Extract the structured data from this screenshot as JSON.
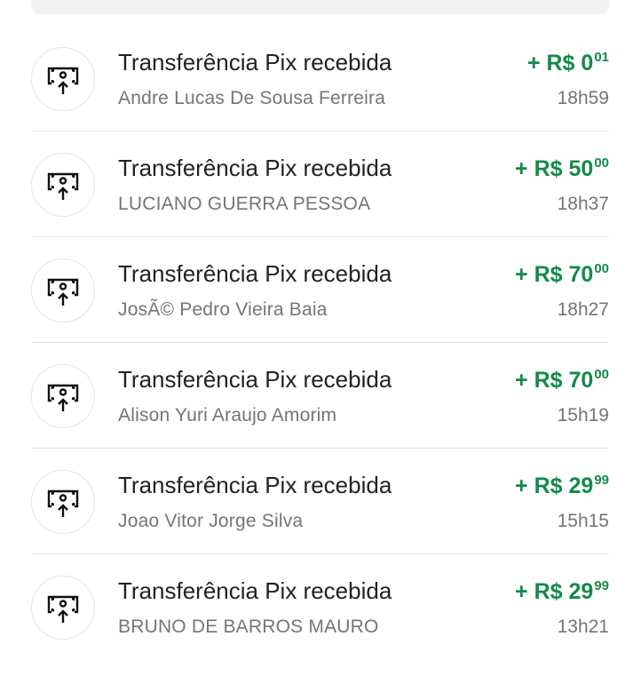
{
  "colors": {
    "amount_green": "#138a4a",
    "title_text": "#222222",
    "secondary_text": "#757575",
    "divider": "#e3e3e3"
  },
  "transactions": [
    {
      "icon": "pix-transfer-received-icon",
      "title": "Transferência Pix recebida",
      "name": "Andre Lucas De Sousa Ferreira",
      "amount_int": "+ R$ 0",
      "amount_cents": "01",
      "time": "18h59"
    },
    {
      "icon": "pix-transfer-received-icon",
      "title": "Transferência Pix recebida",
      "name": "LUCIANO GUERRA PESSOA",
      "amount_int": "+ R$ 50",
      "amount_cents": "00",
      "time": "18h37"
    },
    {
      "icon": "pix-transfer-received-icon",
      "title": "Transferência Pix recebida",
      "name": "JosÃ© Pedro Vieira Baia",
      "amount_int": "+ R$ 70",
      "amount_cents": "00",
      "time": "18h27"
    },
    {
      "icon": "pix-transfer-received-icon",
      "title": "Transferência Pix recebida",
      "name": "Alison Yuri Araujo Amorim",
      "amount_int": "+ R$ 70",
      "amount_cents": "00",
      "time": "15h19"
    },
    {
      "icon": "pix-transfer-received-icon",
      "title": "Transferência Pix recebida",
      "name": "Joao Vitor Jorge Silva",
      "amount_int": "+ R$ 29",
      "amount_cents": "99",
      "time": "15h15"
    },
    {
      "icon": "pix-transfer-received-icon",
      "title": "Transferência Pix recebida",
      "name": "BRUNO DE BARROS MAURO",
      "amount_int": "+ R$ 29",
      "amount_cents": "99",
      "time": "13h21"
    }
  ]
}
